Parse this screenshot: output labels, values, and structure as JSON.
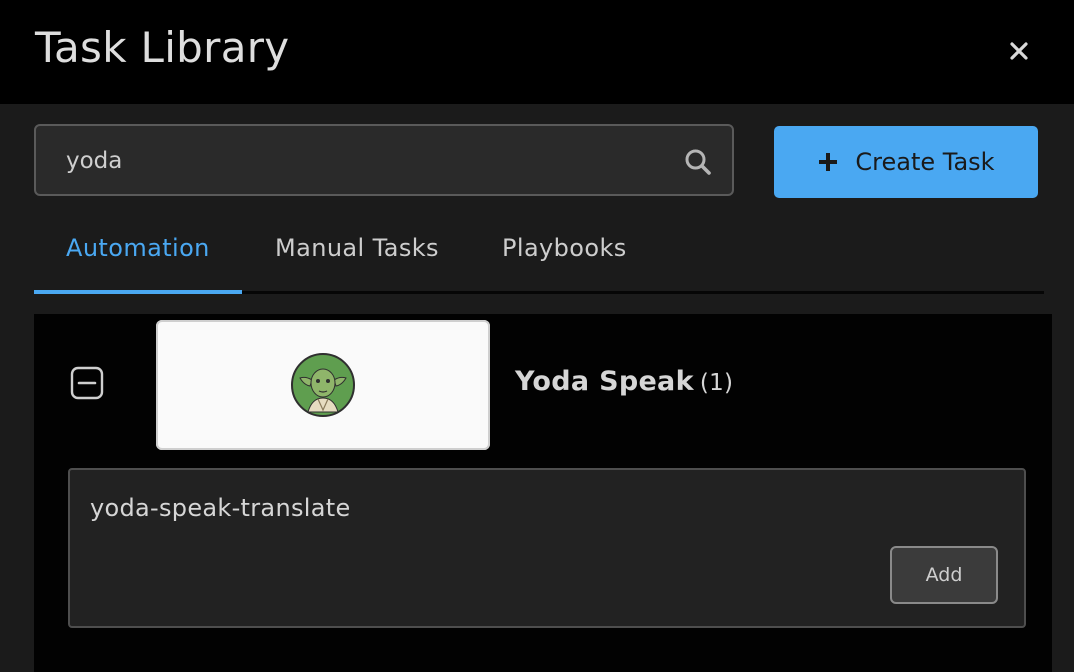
{
  "dialog": {
    "title": "Task Library",
    "close_icon": "close-icon"
  },
  "search": {
    "value": "yoda",
    "icon": "search-icon"
  },
  "create_button": {
    "label": "Create Task",
    "icon": "plus-icon"
  },
  "tabs": [
    {
      "label": "Automation",
      "active": true
    },
    {
      "label": "Manual Tasks",
      "active": false
    },
    {
      "label": "Playbooks",
      "active": false
    }
  ],
  "group": {
    "collapse_icon": "minus-square-icon",
    "logo": "yoda-logo",
    "title": "Yoda Speak",
    "count": "(1)"
  },
  "tasks": [
    {
      "name": "yoda-speak-translate",
      "add_label": "Add"
    }
  ],
  "colors": {
    "accent": "#4aa8f2",
    "header_bg": "#000000",
    "body_bg": "#1b1b1b"
  }
}
